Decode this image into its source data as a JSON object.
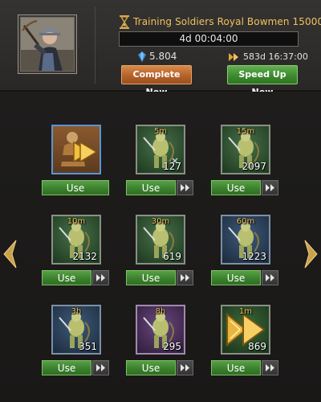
{
  "header": {
    "title": "Training Soldiers Royal Bowmen 15000",
    "timer": "4d 00:04:00",
    "gems": "5.804",
    "speedup_time": "583d 16:37:00",
    "complete_label": "Complete Now",
    "speedup_label": "Speed Up Now"
  },
  "items": [
    {
      "duration": "",
      "count": "",
      "use": "Use"
    },
    {
      "duration": "5m",
      "count": "127",
      "use": "Use"
    },
    {
      "duration": "15m",
      "count": "2097",
      "use": "Use"
    },
    {
      "duration": "10m",
      "count": "2132",
      "use": "Use"
    },
    {
      "duration": "30m",
      "count": "619",
      "use": "Use"
    },
    {
      "duration": "60m",
      "count": "1223",
      "use": "Use"
    },
    {
      "duration": "3h",
      "count": "351",
      "use": "Use"
    },
    {
      "duration": "8h",
      "count": "295",
      "use": "Use"
    },
    {
      "duration": "1m",
      "count": "869",
      "use": "Use"
    }
  ],
  "colors": {
    "accent_gold": "#f0c060",
    "button_green": "#3a7f2c",
    "button_orange": "#b4622a"
  },
  "icons": {
    "header": [
      "hourglass-icon",
      "gem-icon",
      "speedup-arrows-icon"
    ],
    "tiles": [
      "instant-train-icon",
      "training-speedup-icon",
      "fast-forward-icon"
    ]
  }
}
